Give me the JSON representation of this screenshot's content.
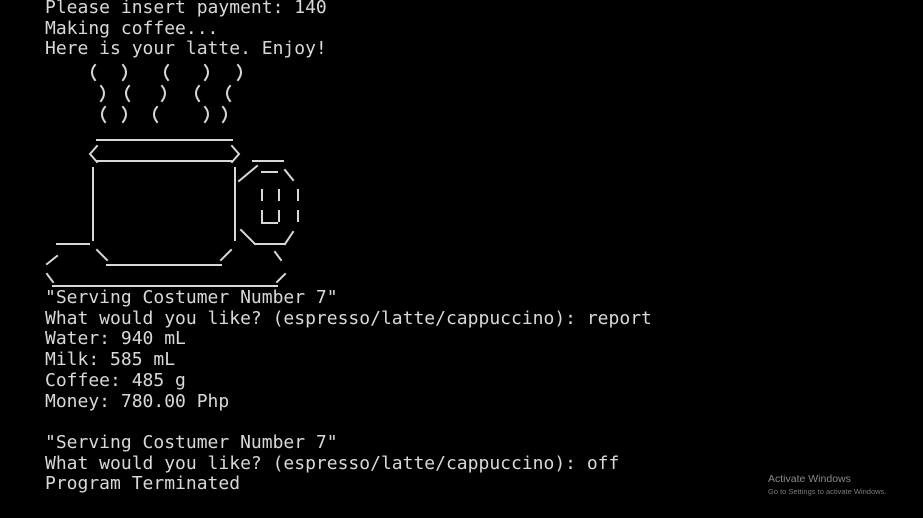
{
  "console": {
    "block1": [
      "Please insert payment: 140",
      "Making coffee...",
      "Here is your latte. Enjoy!"
    ],
    "block2": [
      "\"Serving Costumer Number 7\"",
      "What would you like? (espresso/latte/cappuccino): report",
      "Water: 940 mL",
      "Milk: 585 mL",
      "Coffee: 485 g",
      "Money: 780.00 Php"
    ],
    "block3": [
      "\"Serving Costumer Number 7\"",
      "What would you like? (espresso/latte/cappuccino): off",
      "Program Terminated"
    ]
  },
  "watermark": {
    "title": "Activate Windows",
    "subtitle": "Go to Settings to activate Windows."
  },
  "colors": {
    "background": "#000000",
    "text": "#d8d8d8",
    "watermark": "#8a8a8a"
  }
}
